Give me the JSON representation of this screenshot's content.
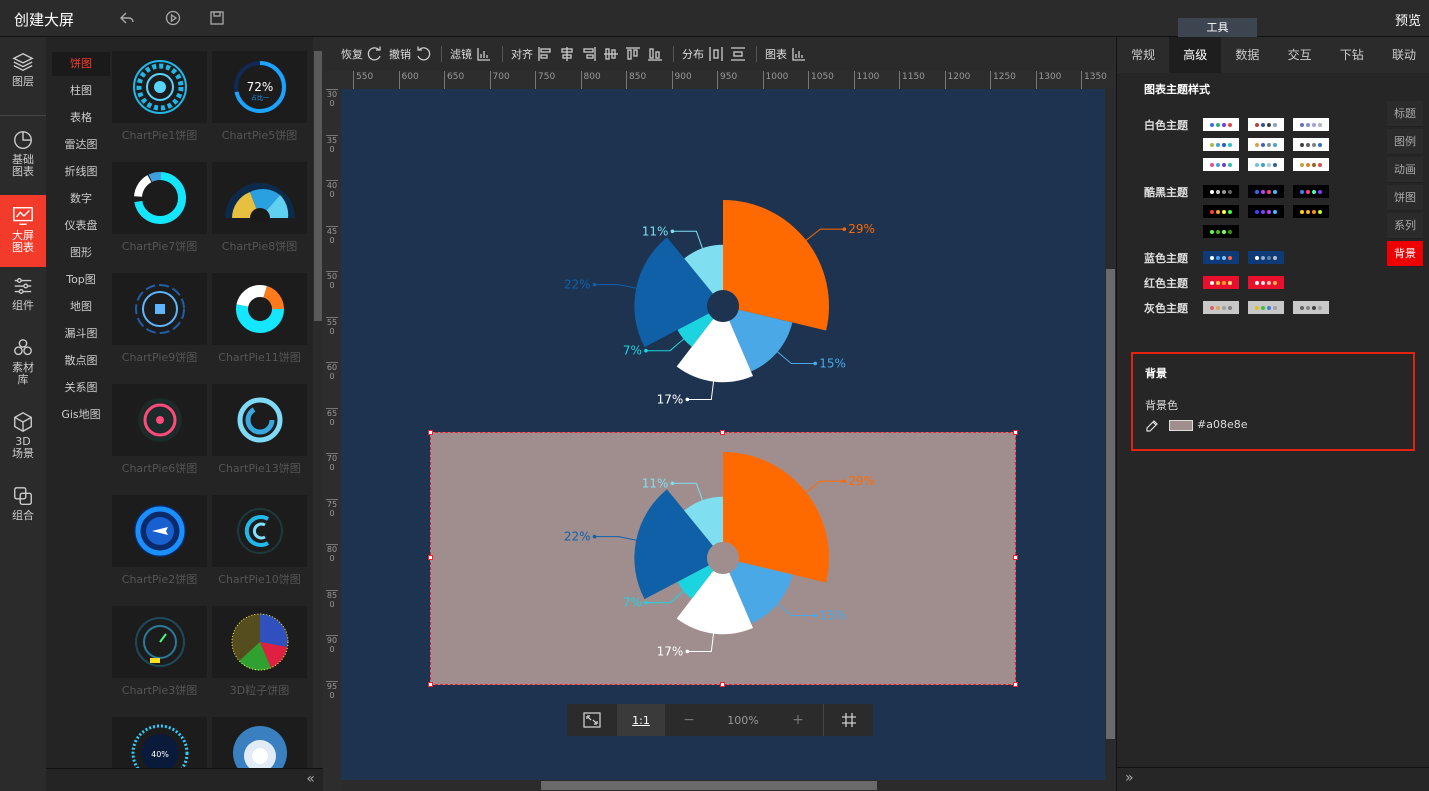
{
  "app": {
    "title": "创建大屏",
    "preview_label": "预览",
    "tools_tab_label": "工具"
  },
  "left_nav": [
    {
      "label": "图层",
      "icon": "layers-icon"
    },
    {
      "label": "基础图表",
      "icon": "pie-chart-icon"
    },
    {
      "label": "大屏图表",
      "icon": "monitor-chart-icon",
      "active": true
    },
    {
      "label": "组件",
      "icon": "sliders-icon"
    },
    {
      "label": "素材库",
      "icon": "hexagons-icon"
    },
    {
      "label": "3D场景",
      "icon": "cube-icon"
    },
    {
      "label": "组合",
      "icon": "group-icon"
    }
  ],
  "categories": [
    "饼图",
    "柱图",
    "表格",
    "雷达图",
    "折线图",
    "数字",
    "仪表盘",
    "图形",
    "Top图",
    "地图",
    "漏斗图",
    "散点图",
    "关系图",
    "Gis地图"
  ],
  "active_category": "饼图",
  "gallery": [
    "ChartPie1饼图",
    "ChartPie5饼图",
    "ChartPie7饼图",
    "ChartPie8饼图",
    "ChartPie9饼图",
    "ChartPie11饼图",
    "ChartPie6饼图",
    "ChartPie13饼图",
    "ChartPie2饼图",
    "ChartPie10饼图",
    "ChartPie3饼图",
    "3D粒子饼图"
  ],
  "gallery_thumb_text": {
    "pie5_value": "72%",
    "pie5_sub": "占比一",
    "last_pct": "40%"
  },
  "toolbar": {
    "redo": "恢复",
    "undo": "撤销",
    "filter": "滤镜",
    "align": "对齐",
    "distribute": "分布",
    "chart": "图表"
  },
  "ruler_marks": [
    "550",
    "600",
    "650",
    "700",
    "750",
    "800",
    "850",
    "900",
    "950",
    "1000",
    "1050",
    "1100",
    "1150",
    "1200",
    "1250",
    "1300",
    "1350"
  ],
  "ruler_v_marks": [
    "300",
    "350",
    "400",
    "450",
    "500",
    "550",
    "600",
    "650",
    "700",
    "750",
    "800",
    "850",
    "900",
    "950"
  ],
  "zoom": {
    "fit_label": "1:1",
    "minus": "−",
    "value": "100%",
    "plus": "+"
  },
  "chart_data": [
    {
      "type": "pie",
      "variant": "rose",
      "categories": [
        "29%",
        "15%",
        "17%",
        "7%",
        "22%",
        "11%"
      ],
      "values": [
        29,
        15,
        17,
        7,
        22,
        11
      ],
      "colors": [
        "#ff6a00",
        "#4aa8e6",
        "#ffffff",
        "#1bd4e0",
        "#1060a8",
        "#7fdff0"
      ],
      "label_colors": [
        "#ff6a00",
        "#4aa8e6",
        "#ffffff",
        "#1bd4e0",
        "#1060a8",
        "#7fdff0"
      ]
    },
    {
      "type": "pie",
      "variant": "rose",
      "background": "#a08e8e",
      "categories": [
        "29%",
        "15%",
        "17%",
        "7%",
        "22%",
        "11%"
      ],
      "values": [
        29,
        15,
        17,
        7,
        22,
        11
      ],
      "colors": [
        "#ff6a00",
        "#4aa8e6",
        "#ffffff",
        "#1bd4e0",
        "#1060a8",
        "#7fdff0"
      ],
      "label_colors": [
        "#ff6a00",
        "#4aa8e6",
        "#ffffff",
        "#1bd4e0",
        "#1060a8",
        "#7fdff0"
      ]
    }
  ],
  "right_tabs": [
    "常规",
    "高级",
    "数据",
    "交互",
    "下钻",
    "联动"
  ],
  "active_right_tab": "高级",
  "theme_section_title": "图表主题样式",
  "themes": [
    {
      "label": "白色主题",
      "bg": "#ffffff",
      "swatches": [
        [
          "#3a6fd8",
          "#2db07a",
          "#7b3fd0",
          "#e04a4a"
        ],
        [
          "#c04040",
          "#3050a0",
          "#404040",
          "#90a0c0"
        ],
        [
          "#6070c0",
          "#8090d0",
          "#a0a0e0",
          "#b0b0c0"
        ],
        [
          "#a0c040",
          "#40a0e0",
          "#2060c0",
          "#30c0c0"
        ],
        [
          "#e0a040",
          "#4060c0",
          "#8090a0",
          "#50a0d0"
        ],
        [
          "#404040",
          "#606060",
          "#808080",
          "#3070c0"
        ],
        [
          "#e05090",
          "#40a0e0",
          "#7040c0",
          "#30c0a0"
        ],
        [
          "#70c0e0",
          "#40a0c0",
          "#a0d0e0",
          "#3060a0"
        ],
        [
          "#c0a040",
          "#e08030",
          "#a06020",
          "#d05050"
        ]
      ]
    },
    {
      "label": "酷黑主题",
      "bg": "#000000",
      "swatches": [
        [
          "#ffffff",
          "#cccccc",
          "#999999",
          "#666666"
        ],
        [
          "#4060ff",
          "#c040ff",
          "#ff4080",
          "#40c0ff"
        ],
        [
          "#4080ff",
          "#ff4060",
          "#40ffc0",
          "#8040ff"
        ],
        [
          "#ff4040",
          "#ffa040",
          "#ffff40",
          "#40ff40"
        ],
        [
          "#4040ff",
          "#8040ff",
          "#c040ff",
          "#40c0ff"
        ],
        [
          "#ffd020",
          "#ffb020",
          "#ff9020",
          "#c0ff20"
        ],
        [
          "#60ff40",
          "#40c020",
          "#80ff60",
          "#30a010"
        ]
      ]
    },
    {
      "label": "蓝色主题",
      "bg": "#0e3a78",
      "swatches": [
        [
          "#ffffff",
          "#40a0ff",
          "#80c0ff",
          "#ff6040"
        ],
        [
          "#ffffff",
          "#90b0d0",
          "#6080a0",
          "#b0c0d0"
        ]
      ]
    },
    {
      "label": "红色主题",
      "bg": "#e8102c",
      "swatches": [
        [
          "#ffffff",
          "#ffd040",
          "#ffa020",
          "#ffe080"
        ],
        [
          "#ffffff",
          "#ffe0e0",
          "#ffc0c0",
          "#ffb040"
        ]
      ]
    },
    {
      "label": "灰色主题",
      "bg": "#c8c8c8",
      "swatches": [
        [
          "#e06060",
          "#e0a060",
          "#a0a0a0",
          "#808080"
        ],
        [
          "#e0c020",
          "#40c040",
          "#4080e0",
          "#a0a0a0"
        ],
        [
          "#606060",
          "#808080",
          "#404040",
          "#a0a0a0"
        ]
      ]
    }
  ],
  "side_tabs": [
    "标题",
    "图例",
    "动画",
    "饼图",
    "系列",
    "背景"
  ],
  "active_side_tab": "背景",
  "background_section": {
    "title": "背景",
    "color_label": "背景色",
    "color_value": "#a08e8e"
  }
}
